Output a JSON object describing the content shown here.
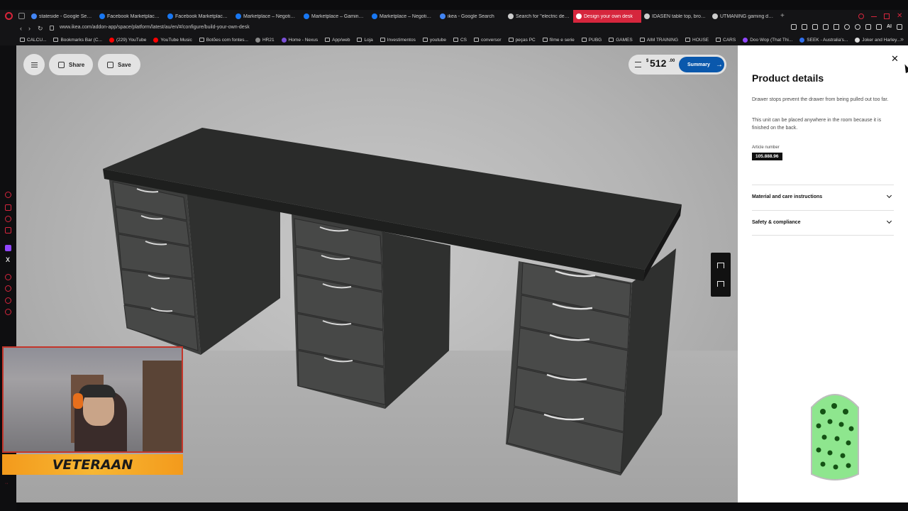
{
  "browser": {
    "tabs": [
      {
        "label": "stateside - Google Search",
        "icon": "google-icon",
        "color": "#4285f4"
      },
      {
        "label": "Facebook Marketplace | F...",
        "icon": "facebook-icon",
        "color": "#1877f2"
      },
      {
        "label": "Facebook Marketplace | F...",
        "icon": "facebook-icon",
        "color": "#1877f2"
      },
      {
        "label": "Marketplace – Negotiable",
        "icon": "facebook-icon",
        "color": "#1877f2"
      },
      {
        "label": "Marketplace – Gaming PC",
        "icon": "facebook-icon",
        "color": "#1877f2"
      },
      {
        "label": "Marketplace – Negotiable",
        "icon": "facebook-icon",
        "color": "#1877f2"
      },
      {
        "label": "ikea - Google Search",
        "icon": "google-icon",
        "color": "#4285f4"
      },
      {
        "label": "Search for \"electric desk\"",
        "icon": "ikea-icon",
        "color": "#cccccc"
      },
      {
        "label": "Design your own desk",
        "icon": "ikea-icon",
        "color": "#ffffff",
        "active": true
      },
      {
        "label": "IDÅSEN table top, brown, ...",
        "icon": "ikea-icon",
        "color": "#cccccc"
      },
      {
        "label": "UTMANING gaming desk o...",
        "icon": "ikea-icon",
        "color": "#cccccc"
      }
    ],
    "url": "www.ikea.com/addon-app/space/platform/latest/au/en/#/configure/build-your-own-desk",
    "ai_label": "AI",
    "bookmarks": [
      {
        "label": "CALCU...",
        "type": "folder"
      },
      {
        "label": "Bookmarks Bar (C...",
        "type": "folder"
      },
      {
        "label": "(229) YouTube",
        "type": "site",
        "color": "#ff0000"
      },
      {
        "label": "YouTube Music",
        "type": "site",
        "color": "#ff0000"
      },
      {
        "label": "Botões com fontes...",
        "type": "folder"
      },
      {
        "label": "HR21",
        "type": "site",
        "color": "#888888"
      },
      {
        "label": "Home - Nexus",
        "type": "site",
        "color": "#7a4fd6"
      },
      {
        "label": "App/web",
        "type": "folder"
      },
      {
        "label": "Loja",
        "type": "folder"
      },
      {
        "label": "Investimentos",
        "type": "folder"
      },
      {
        "label": "youtube",
        "type": "folder"
      },
      {
        "label": "CS",
        "type": "folder"
      },
      {
        "label": "conversor",
        "type": "folder"
      },
      {
        "label": "peças PC",
        "type": "folder"
      },
      {
        "label": "filme e serie",
        "type": "folder"
      },
      {
        "label": "PUBG",
        "type": "folder"
      },
      {
        "label": "GAMES",
        "type": "folder"
      },
      {
        "label": "AIM TRAINING",
        "type": "folder"
      },
      {
        "label": "HOUSE",
        "type": "folder"
      },
      {
        "label": "CARS",
        "type": "folder"
      },
      {
        "label": "Doo Wop (That Thi...",
        "type": "site",
        "color": "#9146ff"
      },
      {
        "label": "SEEK - Australia's...",
        "type": "site",
        "color": "#2f6fed"
      },
      {
        "label": "Joker and Harley...",
        "type": "site",
        "color": "#dddddd"
      }
    ]
  },
  "toolbar": {
    "share_label": "Share",
    "save_label": "Save"
  },
  "price": {
    "currency": "$",
    "amount": "512",
    "cents": ".00",
    "summary_label": "Summary"
  },
  "panel": {
    "title": "Product details",
    "description": [
      "Drawer stops prevent the drawer from being pulled out too far.",
      "This unit can be placed anywhere in the room because it is finished on the back."
    ],
    "article_label": "Article number",
    "article_number": "105.888.96",
    "accordions": [
      {
        "label": "Material and care instructions"
      },
      {
        "label": "Safety & compliance"
      }
    ]
  },
  "overlay": {
    "banner_text": "VETERAAN"
  },
  "colors": {
    "accent_red": "#d6263d",
    "ikea_blue": "#0a58ac"
  }
}
